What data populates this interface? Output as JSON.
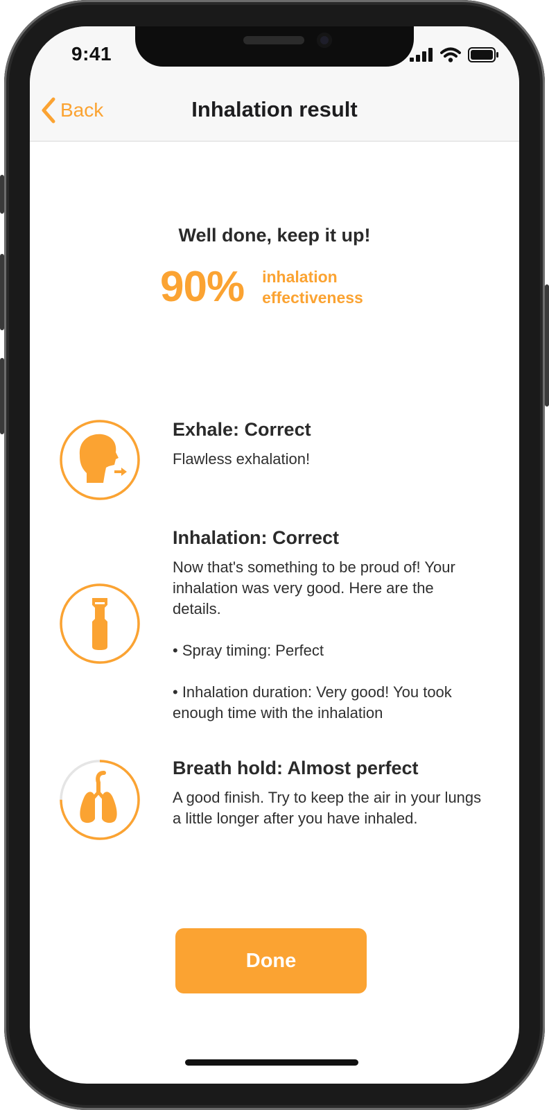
{
  "status_bar": {
    "time": "9:41"
  },
  "nav": {
    "back_label": "Back",
    "title": "Inhalation result"
  },
  "summary": {
    "headline": "Well done, keep it up!",
    "score": "90%",
    "score_value": 0.9,
    "score_label": "inhalation effectiveness"
  },
  "results": [
    {
      "icon": "exhale-face-icon",
      "title": "Exhale: Correct",
      "description": "Flawless exhalation!",
      "progress": 1.0
    },
    {
      "icon": "inhaler-icon",
      "title": "Inhalation: Correct",
      "description": "Now that's something to be proud of! Your inhalation was very good. Here are the details.\n\n• Spray timing: Perfect\n\n• Inhalation duration: Very good! You took enough time with the inhalation",
      "progress": 1.0
    },
    {
      "icon": "lungs-icon",
      "title": "Breath hold: Almost perfect",
      "description": "A good finish. Try to keep the air in your lungs a little longer after you have inhaled.",
      "progress": 0.75
    }
  ],
  "done_label": "Done",
  "colors": {
    "accent": "#fba332",
    "text": "#2a2a2a",
    "track": "#e5e5e5",
    "nav_bg": "#f7f7f7"
  }
}
